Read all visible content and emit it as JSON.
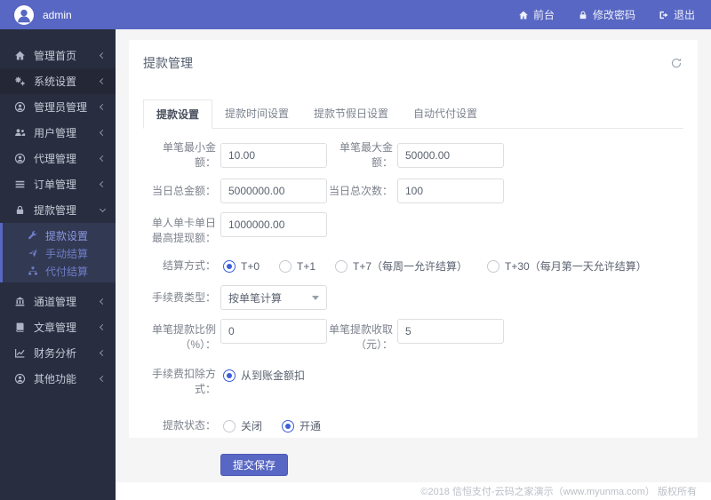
{
  "header": {
    "username": "admin",
    "nav": [
      {
        "label": "前台",
        "icon": "home-icon"
      },
      {
        "label": "修改密码",
        "icon": "lock-icon"
      },
      {
        "label": "退出",
        "icon": "logout-icon"
      }
    ]
  },
  "sidebar": {
    "items": [
      {
        "label": "管理首页",
        "icon": "home-icon",
        "state": "collapsed"
      },
      {
        "label": "系统设置",
        "icon": "gears-icon",
        "state": "collapsed"
      },
      {
        "label": "管理员管理",
        "icon": "admin-user-icon",
        "state": "collapsed"
      },
      {
        "label": "用户管理",
        "icon": "users-icon",
        "state": "collapsed"
      },
      {
        "label": "代理管理",
        "icon": "agent-user-icon",
        "state": "collapsed"
      },
      {
        "label": "订单管理",
        "icon": "list-icon",
        "state": "collapsed"
      },
      {
        "label": "提款管理",
        "icon": "lock-icon",
        "state": "expanded"
      },
      {
        "label": "通道管理",
        "icon": "bank-icon",
        "state": "collapsed"
      },
      {
        "label": "文章管理",
        "icon": "book-icon",
        "state": "collapsed"
      },
      {
        "label": "财务分析",
        "icon": "chart-icon",
        "state": "collapsed"
      },
      {
        "label": "其他功能",
        "icon": "user-circle-icon",
        "state": "collapsed"
      }
    ],
    "submenu": [
      {
        "label": "提款设置",
        "icon": "wrench-icon",
        "active": true
      },
      {
        "label": "手动结算",
        "icon": "send-icon",
        "active": false
      },
      {
        "label": "代付结算",
        "icon": "sitemap-icon",
        "active": false
      }
    ]
  },
  "card": {
    "title": "提款管理",
    "tabs": [
      {
        "label": "提款设置",
        "active": true
      },
      {
        "label": "提款时间设置",
        "active": false
      },
      {
        "label": "提款节假日设置",
        "active": false
      },
      {
        "label": "自动代付设置",
        "active": false
      }
    ]
  },
  "form": {
    "min_amount": {
      "label": "单笔最小金额：",
      "value": "10.00"
    },
    "max_amount": {
      "label": "单笔最大金额：",
      "value": "50000.00"
    },
    "daily_total": {
      "label": "当日总金额：",
      "value": "5000000.00"
    },
    "daily_count": {
      "label": "当日总次数：",
      "value": "100"
    },
    "card_daily_max": {
      "label": "单人单卡单日最高提现额：",
      "value": "1000000.00"
    },
    "settle_mode": {
      "label": "结算方式：",
      "options": [
        "T+0",
        "T+1",
        "T+7（每周一允许结算）",
        "T+30（每月第一天允许结算）"
      ],
      "selected": "T+0"
    },
    "fee_type": {
      "label": "手续费类型：",
      "value": "按单笔计算"
    },
    "fee_percent": {
      "label": "单笔提款比例（%）：",
      "value": "0"
    },
    "fee_fixed": {
      "label": "单笔提款收取（元）：",
      "value": "5"
    },
    "fee_deduct": {
      "label": "手续费扣除方式：",
      "options": [
        "从到账金额扣"
      ],
      "selected": "从到账金额扣"
    },
    "status": {
      "label": "提款状态：",
      "options": [
        "关闭",
        "开通"
      ],
      "selected": "开通"
    },
    "submit_label": "提交保存"
  },
  "footer": {
    "copyright": "©2018 信恒支付-云码之家演示（www.myunma.com） 版权所有"
  },
  "colors": {
    "brand": "#5867c3",
    "sidebar_bg": "#282d40",
    "submenu_accent": "#5867c3",
    "radio_checked": "#3b5fd9",
    "content_bg": "#f5f5f6"
  }
}
